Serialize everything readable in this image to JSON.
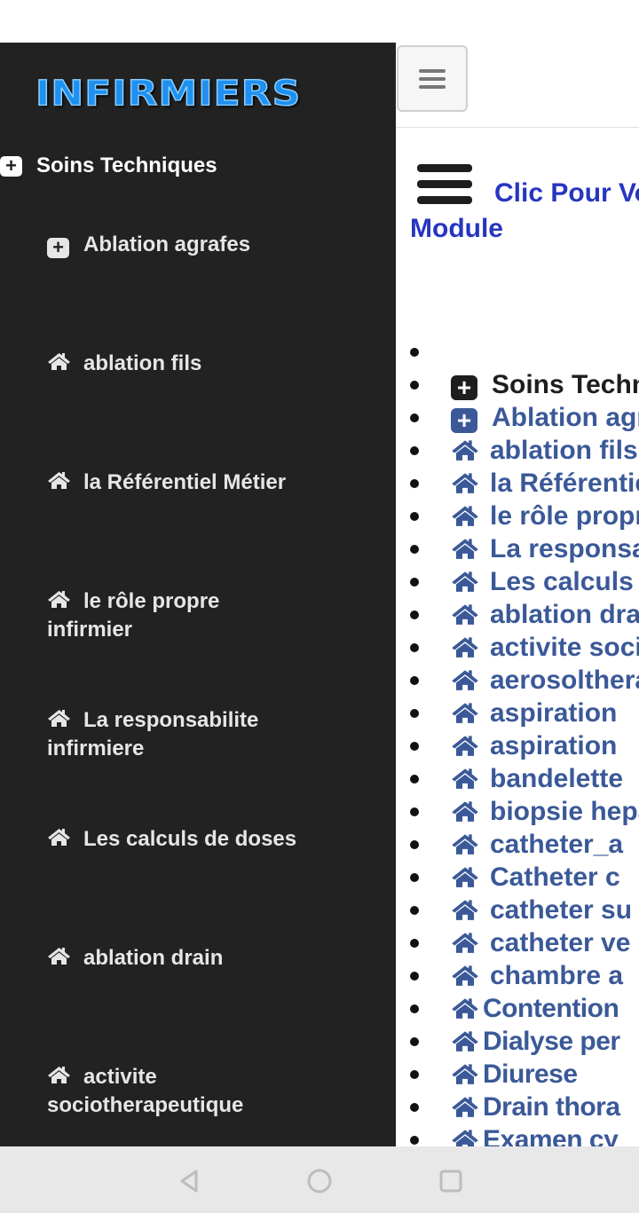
{
  "sidebar": {
    "logo": "INFIRMIERS",
    "heading": "Soins Techniques",
    "items": [
      {
        "label": "Ablation agrafes",
        "icon": "plus-square-icon"
      },
      {
        "label": "ablation fils",
        "icon": "home-icon"
      },
      {
        "label": "la Référentiel Métier",
        "icon": "home-icon"
      },
      {
        "label": "le rôle propre infirmier",
        "icon": "home-icon"
      },
      {
        "label": "La responsabilite infirmiere",
        "icon": "home-icon"
      },
      {
        "label": "Les calculs de doses",
        "icon": "home-icon"
      },
      {
        "label": "ablation drain",
        "icon": "home-icon"
      },
      {
        "label": "activite sociotherapeutique",
        "icon": "home-icon"
      }
    ]
  },
  "main": {
    "clic_line1": "Clic Pour Voir",
    "clic_line2": "Module",
    "list": [
      {
        "label": "",
        "icon": ""
      },
      {
        "label": "Soins Techniques",
        "icon": "plus-square-icon"
      },
      {
        "label": "Ablation agrafes",
        "icon": "plus-square-icon"
      },
      {
        "label": "ablation fils",
        "icon": "home-icon"
      },
      {
        "label": "la Référentiel Métier",
        "icon": "home-icon"
      },
      {
        "label": "le rôle propre infirmier",
        "icon": "home-icon"
      },
      {
        "label": "La responsabilite infirmiere",
        "icon": "home-icon"
      },
      {
        "label": "Les calculs de doses",
        "icon": "home-icon"
      },
      {
        "label": "ablation drain",
        "icon": "home-icon"
      },
      {
        "label": "activite sociotherapeutique",
        "icon": "home-icon"
      },
      {
        "label": "aerosoltherapie",
        "icon": "home-icon"
      },
      {
        "label": "aspiration",
        "icon": "home-icon"
      },
      {
        "label": "aspiration",
        "icon": "home-icon"
      },
      {
        "label": "bandelette",
        "icon": "home-icon"
      },
      {
        "label": "biopsie hepatique",
        "icon": "home-icon"
      },
      {
        "label": "catheter_a",
        "icon": "home-icon"
      },
      {
        "label": "Catheter c",
        "icon": "home-icon"
      },
      {
        "label": "catheter su",
        "icon": "home-icon"
      },
      {
        "label": "catheter ve",
        "icon": "home-icon"
      },
      {
        "label": "chambre a",
        "icon": "home-icon"
      },
      {
        "label": "Contention",
        "icon": "home-icon"
      },
      {
        "label": "Dialyse per",
        "icon": "home-icon"
      },
      {
        "label": "Diurese",
        "icon": "home-icon"
      },
      {
        "label": "Drain thora",
        "icon": "home-icon"
      },
      {
        "label": "Examen cy",
        "icon": "home-icon"
      }
    ]
  },
  "colors": {
    "sidebar_bg": "#222222",
    "link_blue": "#3b5998",
    "clic_blue": "#2636c0",
    "logo_blue": "#1e90f0"
  }
}
